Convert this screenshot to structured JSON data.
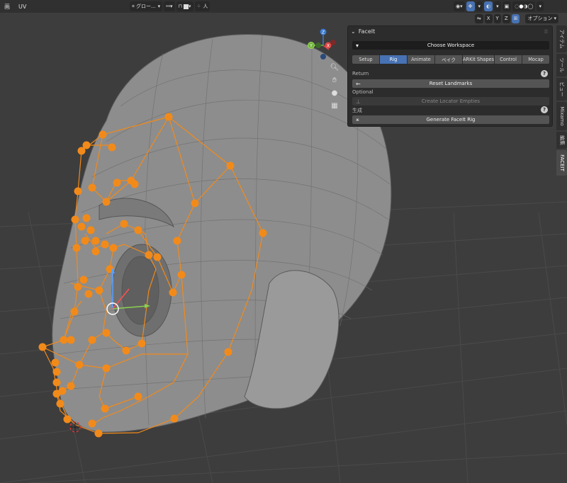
{
  "header": {
    "menu": [
      "画",
      "UV"
    ],
    "orientation": "グロー...",
    "snap_menu": "人",
    "options": "オプション",
    "axes": [
      "X",
      "Y",
      "Z"
    ]
  },
  "gizmo": {
    "x": "X",
    "y": "Y",
    "z": "Z"
  },
  "panel": {
    "title": "FaceIt",
    "choose_workspace": "Choose Workspace",
    "tabs": [
      {
        "label": "Setup",
        "active": false
      },
      {
        "label": "Rig",
        "active": true
      },
      {
        "label": "Animate",
        "active": false
      },
      {
        "label": "ベイク",
        "active": false
      },
      {
        "label": "ARKit Shapes",
        "active": false
      },
      {
        "label": "Control",
        "active": false
      },
      {
        "label": "Mocap",
        "active": false
      }
    ],
    "return_label": "Return",
    "reset_landmarks": "Reset Landmarks",
    "optional_label": "Optional",
    "create_locators": "Create Locator Empties",
    "generate_label": "生成",
    "generate_rig": "Generate FaceIt Rig"
  },
  "side_tabs": [
    "アイテム",
    "ツール",
    "ビュー",
    "Mixamo",
    "編集",
    "FACEIT"
  ],
  "colors": {
    "accent": "#4772b3",
    "landmark": "#f28a1a",
    "mesh": "#8d8d8d"
  }
}
